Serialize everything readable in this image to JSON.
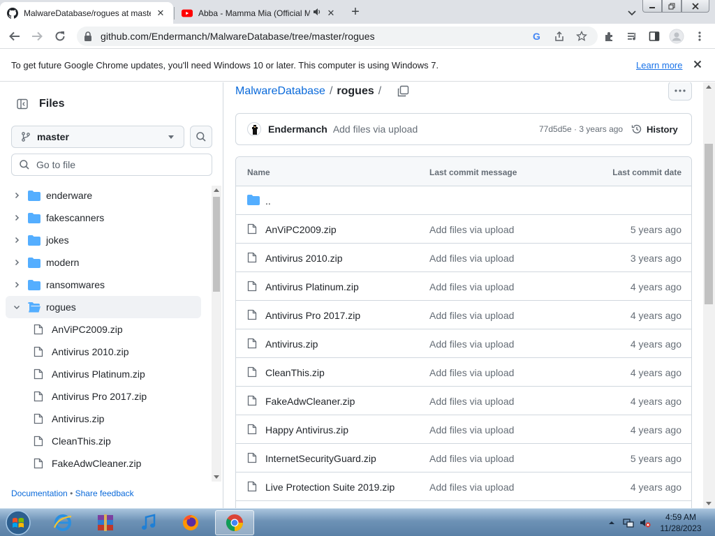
{
  "browser": {
    "tabs": [
      {
        "title": "MalwareDatabase/rogues at master · Endermanch/MalwareDatabase",
        "active": true,
        "favicon": "github-icon"
      },
      {
        "title": "Abba - Mamma Mia (Official Music Video)",
        "active": false,
        "favicon": "youtube-icon",
        "audio": "speaker-icon"
      }
    ],
    "new_tab_label": "+",
    "url": "github.com/Endermanch/MalwareDatabase/tree/master/rogues",
    "update_message": "To get future Google Chrome updates, you'll need Windows 10 or later. This computer is using Windows 7.",
    "learn_more": "Learn more"
  },
  "sidebar": {
    "title": "Files",
    "branch": "master",
    "goto_placeholder": "Go to file",
    "tree": [
      {
        "label": "enderware",
        "type": "folder",
        "expanded": false
      },
      {
        "label": "fakescanners",
        "type": "folder",
        "expanded": false
      },
      {
        "label": "jokes",
        "type": "folder",
        "expanded": false
      },
      {
        "label": "modern",
        "type": "folder",
        "expanded": false
      },
      {
        "label": "ransomwares",
        "type": "folder",
        "expanded": false
      },
      {
        "label": "rogues",
        "type": "folder",
        "expanded": true,
        "selected": true
      },
      {
        "label": "AnViPC2009.zip",
        "type": "file"
      },
      {
        "label": "Antivirus 2010.zip",
        "type": "file"
      },
      {
        "label": "Antivirus Platinum.zip",
        "type": "file"
      },
      {
        "label": "Antivirus Pro 2017.zip",
        "type": "file"
      },
      {
        "label": "Antivirus.zip",
        "type": "file"
      },
      {
        "label": "CleanThis.zip",
        "type": "file"
      },
      {
        "label": "FakeAdwCleaner.zip",
        "type": "file"
      }
    ],
    "footer": {
      "documentation": "Documentation",
      "separator": "•",
      "feedback": "Share feedback"
    }
  },
  "main": {
    "breadcrumb": {
      "repo": "MalwareDatabase",
      "sep": "/",
      "current": "rogues",
      "trail": "/"
    },
    "commit": {
      "author": "Endermanch",
      "message": "Add files via upload",
      "meta": "77d5d5e · 3 years ago",
      "history": "History"
    },
    "table": {
      "headers": {
        "name": "Name",
        "message": "Last commit message",
        "date": "Last commit date"
      },
      "parent": "..",
      "rows": [
        {
          "name": "AnViPC2009.zip",
          "message": "Add files via upload",
          "date": "5 years ago"
        },
        {
          "name": "Antivirus 2010.zip",
          "message": "Add files via upload",
          "date": "3 years ago"
        },
        {
          "name": "Antivirus Platinum.zip",
          "message": "Add files via upload",
          "date": "4 years ago"
        },
        {
          "name": "Antivirus Pro 2017.zip",
          "message": "Add files via upload",
          "date": "4 years ago"
        },
        {
          "name": "Antivirus.zip",
          "message": "Add files via upload",
          "date": "4 years ago"
        },
        {
          "name": "CleanThis.zip",
          "message": "Add files via upload",
          "date": "4 years ago"
        },
        {
          "name": "FakeAdwCleaner.zip",
          "message": "Add files via upload",
          "date": "4 years ago"
        },
        {
          "name": "Happy Antivirus.zip",
          "message": "Add files via upload",
          "date": "4 years ago"
        },
        {
          "name": "InternetSecurityGuard.zip",
          "message": "Add files via upload",
          "date": "5 years ago"
        },
        {
          "name": "Live Protection Suite 2019.zip",
          "message": "Add files via upload",
          "date": "4 years ago"
        }
      ]
    }
  },
  "taskbar": {
    "apps": [
      "windows-start-icon",
      "internet-explorer-icon",
      "winrar-icon",
      "itunes-icon",
      "firefox-icon",
      "chrome-icon"
    ],
    "time": "4:59 AM",
    "date": "11/28/2023"
  },
  "colors": {
    "link": "#0969da",
    "folder": "#54aeff",
    "border": "#d0d7de",
    "muted": "#656d76"
  }
}
